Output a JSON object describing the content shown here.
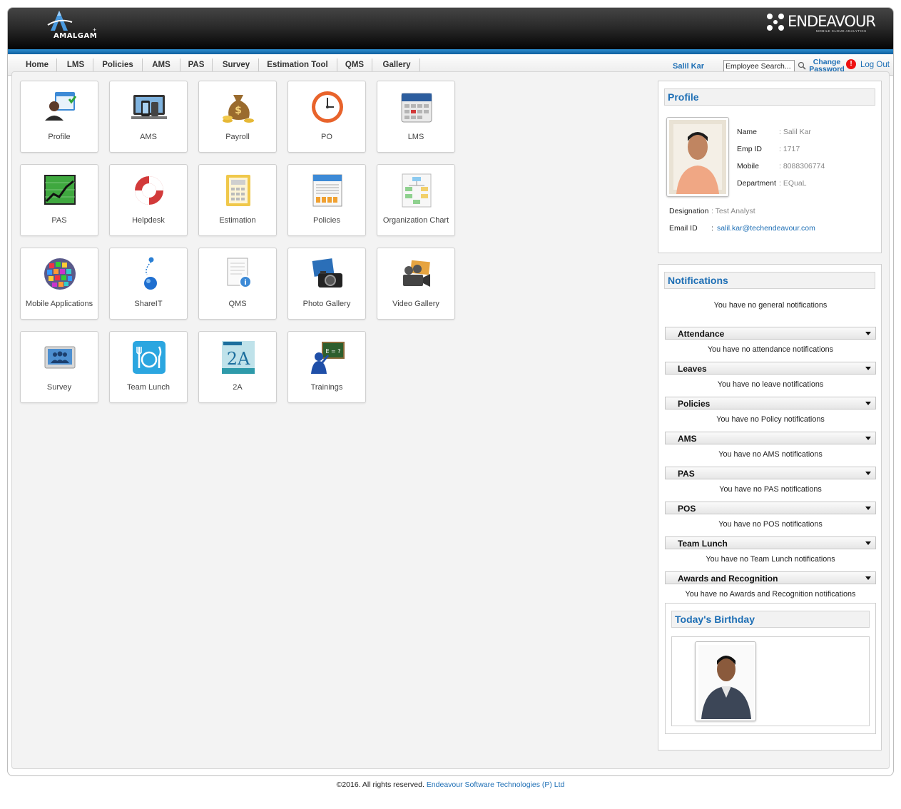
{
  "header": {
    "app_logo_text": "AMALGAM",
    "app_logo_plus": "+",
    "company_logo_text": "ENDEAVOUR",
    "company_tagline": "MOBILE CLOUD ANALYTICS"
  },
  "nav": {
    "items": [
      "Home",
      "LMS",
      "Policies",
      "AMS",
      "PAS",
      "Survey",
      "Estimation Tool",
      "QMS",
      "Gallery"
    ],
    "user_name": "Salil Kar",
    "search_value": "Employee Search...",
    "change_password": "Change Password",
    "logout": "Log Out"
  },
  "tiles": [
    {
      "label": "Profile",
      "icon": "profile-icon"
    },
    {
      "label": "AMS",
      "icon": "ams-devices-icon"
    },
    {
      "label": "Payroll",
      "icon": "payroll-moneybag-icon"
    },
    {
      "label": "PO",
      "icon": "po-clock-icon"
    },
    {
      "label": "LMS",
      "icon": "lms-calendar-icon"
    },
    {
      "label": "PAS",
      "icon": "pas-chart-icon"
    },
    {
      "label": "Helpdesk",
      "icon": "helpdesk-lifebuoy-icon"
    },
    {
      "label": "Estimation",
      "icon": "estimation-calculator-icon"
    },
    {
      "label": "Policies",
      "icon": "policies-document-icon"
    },
    {
      "label": "Organization Chart",
      "icon": "org-chart-icon"
    },
    {
      "label": "Mobile Applications",
      "icon": "mobile-apps-globe-icon"
    },
    {
      "label": "ShareIT",
      "icon": "shareit-icon"
    },
    {
      "label": "QMS",
      "icon": "qms-document-icon"
    },
    {
      "label": "Photo Gallery",
      "icon": "photo-camera-icon"
    },
    {
      "label": "Video Gallery",
      "icon": "video-camera-icon"
    },
    {
      "label": "Survey",
      "icon": "survey-group-icon"
    },
    {
      "label": "Team Lunch",
      "icon": "team-lunch-icon"
    },
    {
      "label": "2A",
      "icon": "awards-2a-icon"
    },
    {
      "label": "Trainings",
      "icon": "trainings-teacher-icon"
    }
  ],
  "profile": {
    "title": "Profile",
    "name_label": "Name",
    "name": ": Salil Kar",
    "empid_label": "Emp ID",
    "empid": ": 1717",
    "mobile_label": "Mobile",
    "mobile": ": 8088306774",
    "department_label": "Department",
    "department": ": EQuaL",
    "designation_label": "Designation",
    "designation": ": Test Analyst",
    "email_label": "Email ID",
    "email_sep": ":",
    "email": "salil.kar@techendeavour.com"
  },
  "notifications": {
    "title": "Notifications",
    "general": "You have no general notifications",
    "sections": [
      {
        "label": "Attendance",
        "message": "You have no attendance notifications"
      },
      {
        "label": "Leaves",
        "message": "You have no leave notifications"
      },
      {
        "label": "Policies",
        "message": "You have no Policy notifications"
      },
      {
        "label": "AMS",
        "message": "You have no AMS notifications"
      },
      {
        "label": "PAS",
        "message": "You have no PAS notifications"
      },
      {
        "label": "POS",
        "message": "You have no POS notifications"
      },
      {
        "label": "Team Lunch",
        "message": "You have no Team Lunch notifications"
      },
      {
        "label": "Awards and Recognition",
        "message": "You have no Awards and Recognition notifications"
      }
    ],
    "birthday_title": "Today's Birthday"
  },
  "footer": {
    "copyright": "©2016. All rights reserved.",
    "company": "Endeavour Software Technologies (P) Ltd"
  }
}
